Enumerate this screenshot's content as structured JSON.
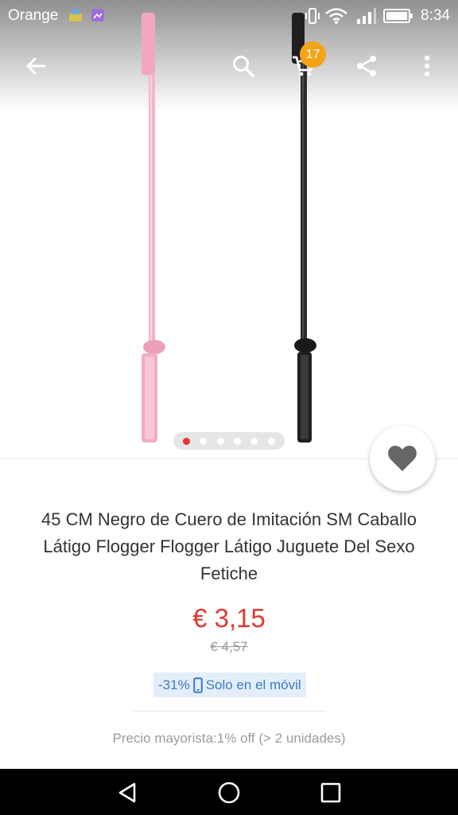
{
  "status_bar": {
    "carrier": "Orange",
    "time": "8:34",
    "icons": [
      "notification-app-icon",
      "gallery-icon",
      "vibrate-icon",
      "wifi-icon",
      "signal-icon",
      "battery-icon"
    ]
  },
  "toolbar": {
    "icons": [
      "back-arrow-icon",
      "search-icon",
      "cart-icon",
      "share-icon",
      "more-vert-icon"
    ],
    "cart_count": "17"
  },
  "gallery": {
    "page_count": 6,
    "active_page": 1,
    "item_colors": [
      "#f4b6c8",
      "#2b2b2b"
    ]
  },
  "product": {
    "title": "45 CM Negro de Cuero de Imitación SM Caballo Látigo Flogger Flogger Látigo Juguete Del Sexo Fetiche",
    "price": "€ 3,15",
    "original_price": "€ 4,57",
    "discount": "-31%",
    "mobile_only": "Solo en el móvil",
    "wholesale": "Precio mayorista:1% off (> 2 unidades)"
  },
  "colors": {
    "accent": "#e2382e",
    "badge": "#f5a317",
    "tag_text": "#3a7bc8",
    "tag_bg": "#e3eefa"
  },
  "nav_bar": {
    "icons": [
      "back-triangle-icon",
      "home-circle-icon",
      "recents-square-icon"
    ]
  }
}
